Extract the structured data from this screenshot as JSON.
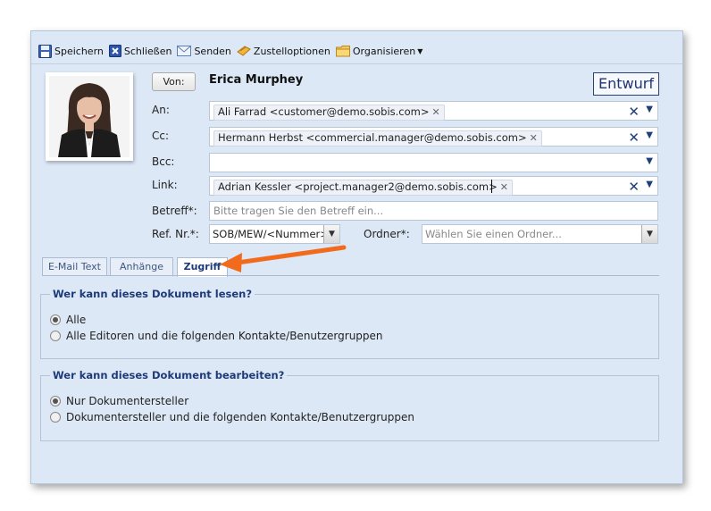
{
  "toolbar": {
    "save": "Speichern",
    "close": "Schließen",
    "send": "Senden",
    "delivery": "Zustelloptionen",
    "organize": "Organisieren"
  },
  "header": {
    "from_button": "Von:",
    "from_name": "Erica Murphey",
    "status": "Entwurf"
  },
  "fields": {
    "to_label": "An:",
    "to_token": "Ali Farrad <customer@demo.sobis.com>",
    "cc_label": "Cc:",
    "cc_token": "Hermann Herbst <commercial.manager@demo.sobis.com>",
    "bcc_label": "Bcc:",
    "link_label": "Link:",
    "link_token": "Adrian Kessler <project.manager2@demo.sobis.com>",
    "subject_label": "Betreff*:",
    "subject_placeholder": "Bitte tragen Sie den Betreff ein...",
    "ref_label": "Ref. Nr.*:",
    "ref_value": "SOB/MEW/<Nummer>",
    "folder_label": "Ordner*:",
    "folder_placeholder": "Wählen Sie einen Ordner..."
  },
  "tabs": [
    "E-Mail Text",
    "Anhänge",
    "Zugriff"
  ],
  "active_tab": "Zugriff",
  "read_access": {
    "legend": "Wer kann dieses Dokument lesen?",
    "options": [
      "Alle",
      "Alle Editoren und die folgenden Kontakte/Benutzergruppen"
    ],
    "selected": "Alle"
  },
  "edit_access": {
    "legend": "Wer kann dieses Dokument bearbeiten?",
    "options": [
      "Nur Dokumentersteller",
      "Dokumentersteller und die folgenden Kontakte/Benutzergruppen"
    ],
    "selected": "Nur Dokumentersteller"
  },
  "colors": {
    "accent": "#1e3a78",
    "annotation_arrow": "#f26b1d",
    "panel_bg": "#dde8f6"
  }
}
